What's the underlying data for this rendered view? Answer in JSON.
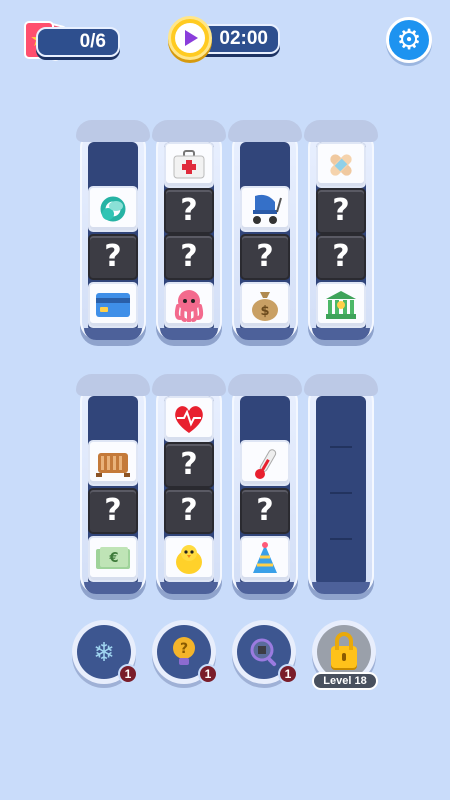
{
  "hud": {
    "cards_count": "0/6",
    "cards_icon": "cards-star-icon",
    "timer": "02:00",
    "timer_icon": "timer-icon",
    "settings_icon": "gear-icon"
  },
  "tubes": [
    {
      "tiles": [
        "hidden-empty",
        "pacifier",
        "?",
        "credit-card"
      ]
    },
    {
      "tiles": [
        "first-aid-kit",
        "?",
        "?",
        "octopus"
      ]
    },
    {
      "tiles": [
        "hidden-empty",
        "stroller",
        "?",
        "money-bag"
      ]
    },
    {
      "tiles": [
        "bandage",
        "?",
        "?",
        "bank"
      ]
    },
    {
      "tiles": [
        "hidden-empty",
        "crib",
        "?",
        "euro-banknote"
      ]
    },
    {
      "tiles": [
        "anatomical-heart",
        "?",
        "?",
        "chick"
      ]
    },
    {
      "tiles": [
        "hidden-empty",
        "thermometer",
        "?",
        "party-hat"
      ]
    },
    {
      "tiles": []
    }
  ],
  "hidden_label": "?",
  "boosters": [
    {
      "icon": "snowflake-icon",
      "count": "1"
    },
    {
      "icon": "lightbulb-hint-icon",
      "count": "1"
    },
    {
      "icon": "magnifier-icon",
      "count": "1"
    }
  ],
  "locked_booster": {
    "icon": "lock-icon",
    "label": "Level 18"
  },
  "colors": {
    "background": "#c9dcfa",
    "tube_inner": "#31457a",
    "hidden_tile": "#3c3c44",
    "badge": "#7a1d2a"
  }
}
